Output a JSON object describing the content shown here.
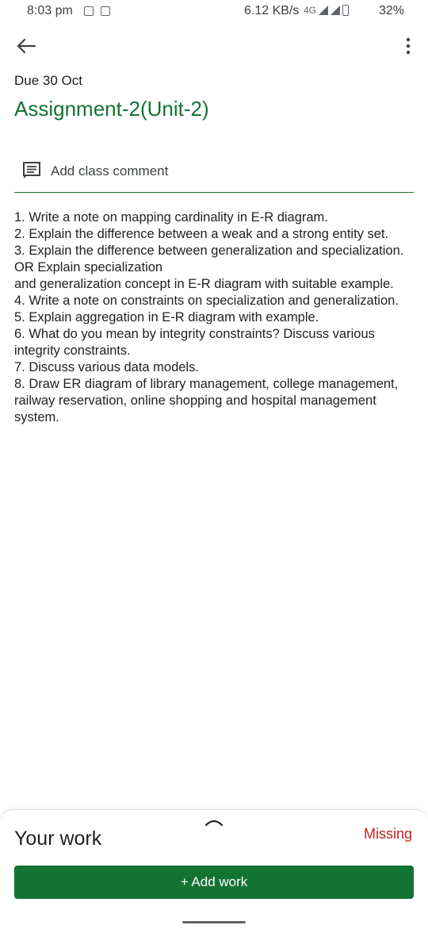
{
  "status_bar": {
    "time": "8:03 pm",
    "speed": "6.12 KB/s",
    "network": "4G",
    "battery": "32%"
  },
  "header": {
    "back_icon": "arrow-left-icon",
    "menu_icon": "more-vert-icon"
  },
  "assignment": {
    "due": "Due 30 Oct",
    "title": "Assignment-2(Unit-2)"
  },
  "comment": {
    "icon": "comment-icon",
    "label": "Add class comment"
  },
  "instructions": [
    "1. Write a note on mapping cardinality in E-R diagram.",
    "2. Explain the difference between a weak and a strong entity set.",
    "3. Explain the difference between generalization and specialization. OR Explain specialization",
    "and generalization concept in E-R diagram with suitable example.",
    "4. Write a note on constraints on specialization and generalization.",
    "5. Explain aggregation in E-R diagram with example.",
    "6. What do you mean by integrity constraints? Discuss various integrity constraints.",
    "7. Discuss various data models.",
    "8. Draw ER diagram of library management, college management, railway reservation, online shopping and hospital management system."
  ],
  "your_work": {
    "title": "Your work",
    "status": "Missing",
    "add_button": "+ Add work"
  },
  "colors": {
    "accent": "#137333",
    "missing": "#c5221f"
  }
}
